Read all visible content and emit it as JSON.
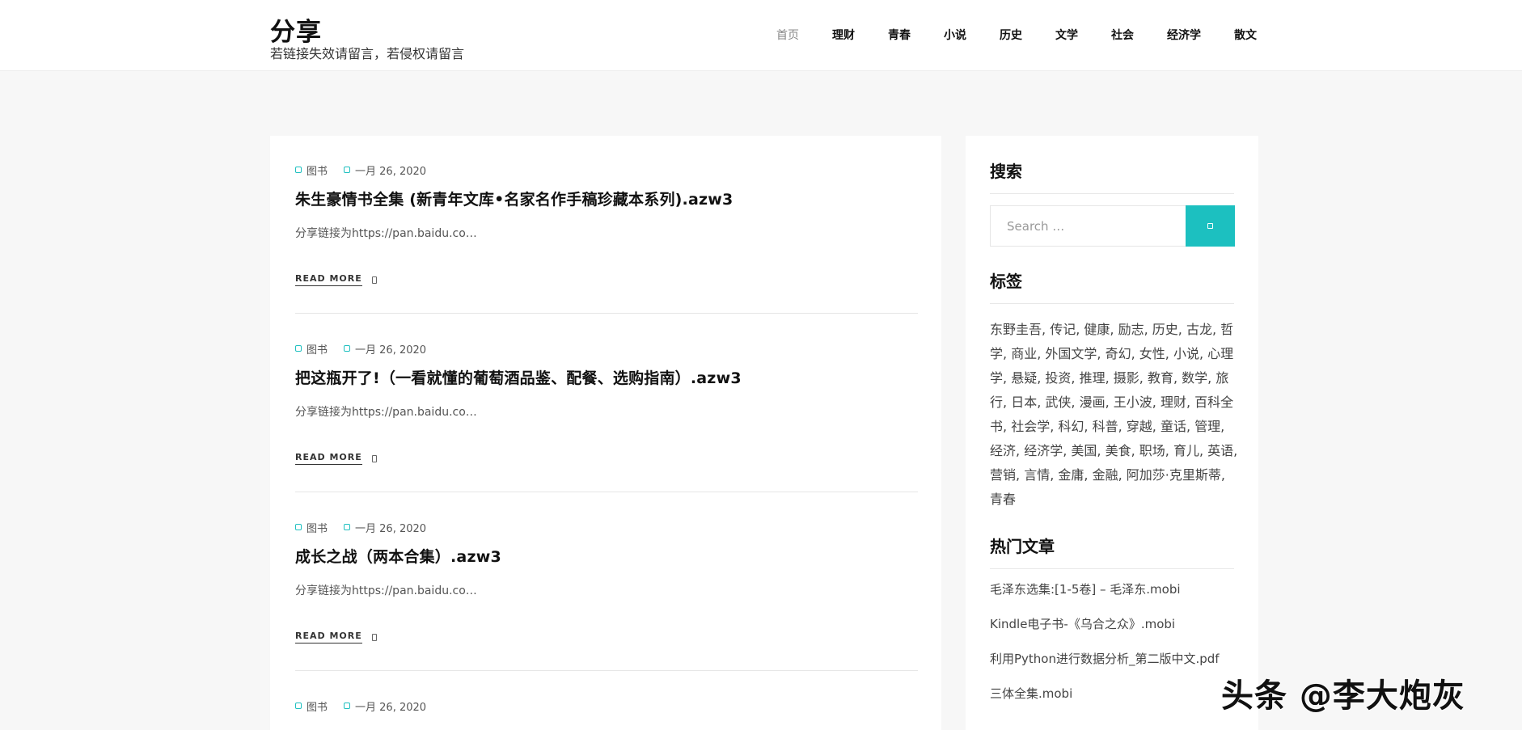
{
  "site": {
    "title": "分享",
    "description": "若链接失效请留言，若侵权请留言"
  },
  "nav": {
    "items": [
      "首页",
      "理财",
      "青春",
      "小说",
      "历史",
      "文学",
      "社会",
      "经济学",
      "散文"
    ]
  },
  "posts": [
    {
      "category": "图书",
      "date": "一月 26, 2020",
      "title": "朱生豪情书全集 (新青年文库•名家名作手稿珍藏本系列).azw3",
      "excerpt": "分享链接为https://pan.baidu.co…",
      "read_more": "READ MORE"
    },
    {
      "category": "图书",
      "date": "一月 26, 2020",
      "title": "把这瓶开了!（一看就懂的葡萄酒品鉴、配餐、选购指南）.azw3",
      "excerpt": "分享链接为https://pan.baidu.co…",
      "read_more": "READ MORE"
    },
    {
      "category": "图书",
      "date": "一月 26, 2020",
      "title": "成长之战（两本合集）.azw3",
      "excerpt": "分享链接为https://pan.baidu.co…",
      "read_more": "READ MORE"
    },
    {
      "category": "图书",
      "date": "一月 26, 2020"
    }
  ],
  "sidebar": {
    "search_title": "搜索",
    "search_placeholder": "Search …",
    "tags_title": "标签",
    "tags": [
      "东野圭吾",
      "传记",
      "健康",
      "励志",
      "历史",
      "古龙",
      "哲学",
      "商业",
      "外国文学",
      "奇幻",
      "女性",
      "小说",
      "心理学",
      "悬疑",
      "投资",
      "推理",
      "摄影",
      "教育",
      "数学",
      "旅行",
      "日本",
      "武侠",
      "漫画",
      "王小波",
      "理财",
      "百科全书",
      "社会学",
      "科幻",
      "科普",
      "穿越",
      "童话",
      "管理",
      "经济",
      "经济学",
      "美国",
      "美食",
      "职场",
      "育儿",
      "英语",
      "营销",
      "言情",
      "金庸",
      "金融",
      "阿加莎·克里斯蒂",
      "青春"
    ],
    "popular_title": "热门文章",
    "popular": [
      "毛泽东选集:[1-5卷] – 毛泽东.mobi",
      "Kindle电子书-《乌合之众》.mobi",
      "利用Python进行数据分析_第二版中文.pdf",
      "三体全集.mobi"
    ]
  },
  "watermark": "头条 @李大炮灰",
  "colors": {
    "accent": "#1cc0c0"
  }
}
